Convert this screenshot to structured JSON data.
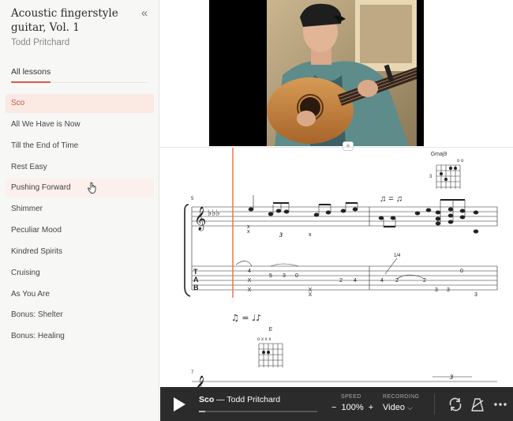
{
  "course": {
    "title": "Acoustic fingerstyle guitar, Vol. 1",
    "author": "Todd Pritchard",
    "collapse_glyph": "«"
  },
  "tabs": {
    "all_lessons": "All lessons"
  },
  "lessons": [
    {
      "label": "Sco",
      "state": "active"
    },
    {
      "label": "All We Have is Now"
    },
    {
      "label": "Till the End of Time"
    },
    {
      "label": "Rest Easy"
    },
    {
      "label": "Pushing Forward",
      "state": "hover"
    },
    {
      "label": "Shimmer"
    },
    {
      "label": "Peculiar Mood"
    },
    {
      "label": "Kindred Spirits"
    },
    {
      "label": "Cruising"
    },
    {
      "label": "As You Are"
    },
    {
      "label": "Bonus: Shelter"
    },
    {
      "label": "Bonus: Healing"
    }
  ],
  "notation": {
    "chord_top": "Gmaj9",
    "chord_fret": "3",
    "chord_bottom": "E",
    "measure_num_1": "5",
    "measure_num_2": "7",
    "triplet": "3",
    "bend": "1/4",
    "tab_letters": [
      "T",
      "A",
      "B"
    ],
    "tab_row_b": [
      "4",
      "5",
      "3",
      "0",
      "2",
      "4",
      "4",
      "2",
      "2",
      "0",
      "3"
    ],
    "tab_row_d": [
      "X",
      "X",
      "X",
      "X",
      "3",
      "3"
    ]
  },
  "player": {
    "track_name": "Sco",
    "track_separator": " — ",
    "track_artist": "Todd Pritchard",
    "progress": 0.05,
    "speed_label": "SPEED",
    "speed_minus": "−",
    "speed_value": "100%",
    "speed_plus": "+",
    "recording_label": "RECORDING",
    "recording_value": "Video",
    "recording_caret": "⌵"
  },
  "colors": {
    "accent": "#e0584a",
    "active_bg": "#fbe9e3",
    "player_bg": "#2b2b2b",
    "playhead": "#e07a52"
  },
  "icons": [
    "collapse-icon",
    "cursor-pointer-icon",
    "play-icon",
    "loop-icon",
    "metronome-icon",
    "more-icon",
    "drag-handle-icon"
  ]
}
